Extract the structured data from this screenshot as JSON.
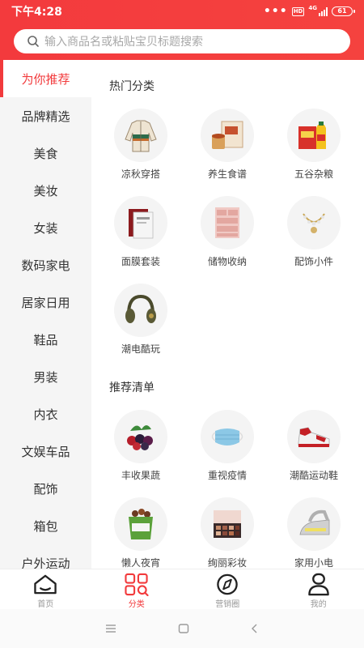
{
  "status_bar": {
    "time": "下午4:28",
    "hd": "HD",
    "network": "4G",
    "battery": "61"
  },
  "search": {
    "placeholder": "输入商品名或粘贴宝贝标题搜索"
  },
  "sidebar": {
    "items": [
      {
        "label": "为你推荐",
        "active": true
      },
      {
        "label": "品牌精选"
      },
      {
        "label": "美食"
      },
      {
        "label": "美妆"
      },
      {
        "label": "女装"
      },
      {
        "label": "数码家电"
      },
      {
        "label": "居家日用"
      },
      {
        "label": "鞋品"
      },
      {
        "label": "男装"
      },
      {
        "label": "内衣"
      },
      {
        "label": "文娱车品"
      },
      {
        "label": "配饰"
      },
      {
        "label": "箱包"
      },
      {
        "label": "户外运动"
      }
    ]
  },
  "sections": [
    {
      "title": "热门分类",
      "items": [
        {
          "label": "凉秋穿搭",
          "icon": "jacket-icon"
        },
        {
          "label": "养生食谱",
          "icon": "tea-box-icon"
        },
        {
          "label": "五谷杂粮",
          "icon": "grain-oil-icon"
        },
        {
          "label": "面膜套装",
          "icon": "mask-box-icon"
        },
        {
          "label": "储物收纳",
          "icon": "drawer-icon"
        },
        {
          "label": "配饰小件",
          "icon": "bracelet-icon"
        },
        {
          "label": "潮电酷玩",
          "icon": "headphones-icon"
        }
      ]
    },
    {
      "title": "推荐清单",
      "items": [
        {
          "label": "丰收果蔬",
          "icon": "berries-icon"
        },
        {
          "label": "重视疫情",
          "icon": "face-mask-icon"
        },
        {
          "label": "潮酷运动鞋",
          "icon": "sneaker-icon"
        },
        {
          "label": "懒人夜宵",
          "icon": "snack-bucket-icon"
        },
        {
          "label": "绚丽彩妆",
          "icon": "eyeshadow-icon"
        },
        {
          "label": "家用小电",
          "icon": "iron-icon"
        }
      ]
    }
  ],
  "tabbar": {
    "items": [
      {
        "label": "首页",
        "icon": "home-icon"
      },
      {
        "label": "分类",
        "icon": "category-icon",
        "active": true
      },
      {
        "label": "营销圈",
        "icon": "compass-icon"
      },
      {
        "label": "我的",
        "icon": "profile-icon"
      }
    ]
  },
  "colors": {
    "accent": "#f23a3c",
    "sidebar_bg": "#f5f5f5"
  }
}
